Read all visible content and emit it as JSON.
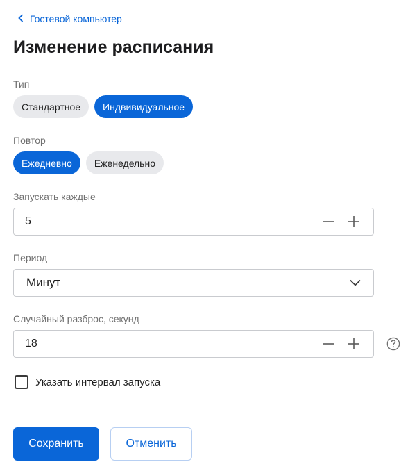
{
  "breadcrumb": {
    "back_label": "Гостевой компьютер"
  },
  "page": {
    "title": "Изменение расписания"
  },
  "type_section": {
    "label": "Тип",
    "options": [
      {
        "label": "Стандартное",
        "selected": false
      },
      {
        "label": "Индвивидуальное",
        "selected": true
      }
    ]
  },
  "repeat_section": {
    "label": "Повтор",
    "options": [
      {
        "label": "Ежедневно",
        "selected": true
      },
      {
        "label": "Еженедельно",
        "selected": false
      }
    ]
  },
  "run_every": {
    "label": "Запускать каждые",
    "value": "5"
  },
  "period": {
    "label": "Период",
    "value": "Минут"
  },
  "random_spread": {
    "label": "Случайный разброс, секунд",
    "value": "18"
  },
  "interval_checkbox": {
    "label": "Указать интервал запуска",
    "checked": false
  },
  "actions": {
    "save_label": "Сохранить",
    "cancel_label": "Отменить"
  },
  "colors": {
    "accent": "#0a66d8",
    "chip_bg": "#e8e9ec",
    "border": "#c9cbcf"
  },
  "icons": {
    "back": "chevron-left-icon",
    "minus": "minus-icon",
    "plus": "plus-icon",
    "dropdown": "chevron-down-icon",
    "help": "question-circle-icon"
  }
}
